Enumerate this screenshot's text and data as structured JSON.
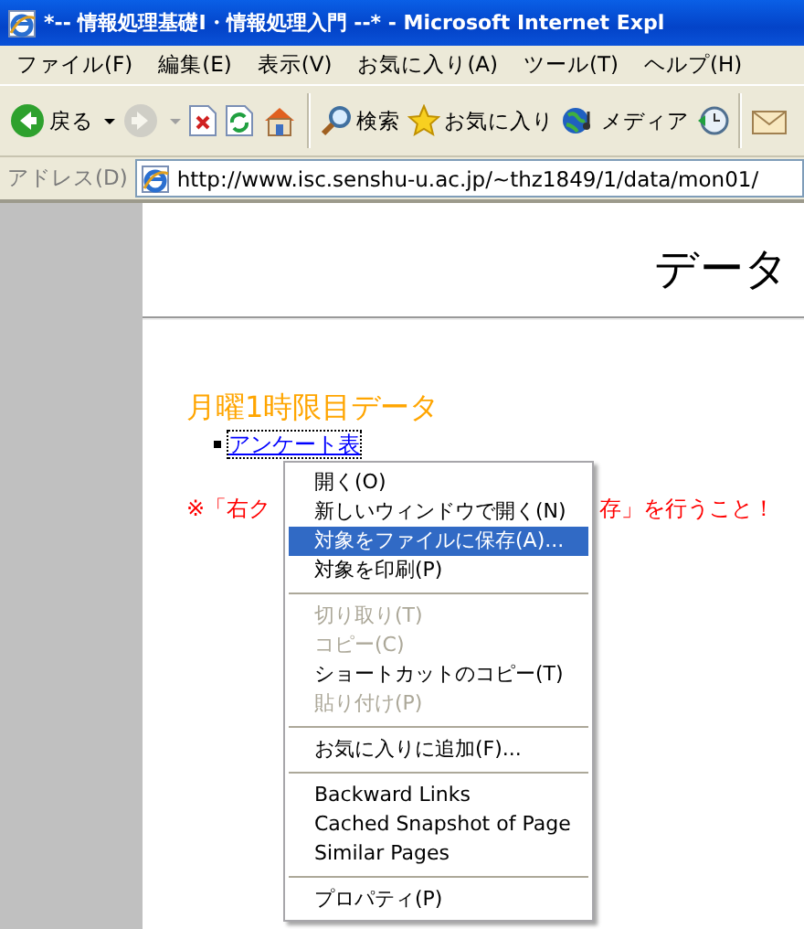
{
  "window": {
    "title": "*-- 情報処理基礎Ⅰ・情報処理入門 --* - Microsoft Internet Expl"
  },
  "menu_bar": [
    "ファイル(F)",
    "編集(E)",
    "表示(V)",
    "お気に入り(A)",
    "ツール(T)",
    "ヘルプ(H)"
  ],
  "toolbar": [
    {
      "kind": "back",
      "label": "戻る",
      "disabled": false
    },
    {
      "kind": "forward",
      "disabled": true
    },
    {
      "kind": "stop",
      "disabled": false
    },
    {
      "kind": "refresh",
      "disabled": false
    },
    {
      "kind": "home",
      "disabled": false
    },
    {
      "kind": "search",
      "label": "検索",
      "disabled": false
    },
    {
      "kind": "favorites",
      "label": "お気に入り",
      "disabled": false
    },
    {
      "kind": "media",
      "label": "メディア",
      "disabled": false
    },
    {
      "kind": "history",
      "disabled": false
    },
    {
      "kind": "mail",
      "disabled": false
    }
  ],
  "address_bar": {
    "label": "アドレス(D)",
    "value": "http://www.isc.senshu-u.ac.jp/~thz1849/1/data/mon01/"
  },
  "page": {
    "heading": "データ",
    "section_title": "月曜1時限目データ",
    "links": [
      "アンケート表"
    ],
    "notice_parts": [
      "※「右ク",
      "存」を行うこと！"
    ]
  },
  "context_menu": [
    {
      "kind": "item",
      "label": "開く(O)",
      "disabled": false,
      "selected": false
    },
    {
      "kind": "item",
      "label": "新しいウィンドウで開く(N)",
      "disabled": false,
      "selected": false
    },
    {
      "kind": "item",
      "label": "対象をファイルに保存(A)...",
      "disabled": false,
      "selected": true
    },
    {
      "kind": "item",
      "label": "対象を印刷(P)",
      "disabled": false,
      "selected": false
    },
    {
      "kind": "separator"
    },
    {
      "kind": "item",
      "label": "切り取り(T)",
      "disabled": true,
      "selected": false
    },
    {
      "kind": "item",
      "label": "コピー(C)",
      "disabled": true,
      "selected": false
    },
    {
      "kind": "item",
      "label": "ショートカットのコピー(T)",
      "disabled": false,
      "selected": false
    },
    {
      "kind": "item",
      "label": "貼り付け(P)",
      "disabled": true,
      "selected": false
    },
    {
      "kind": "separator"
    },
    {
      "kind": "item",
      "label": "お気に入りに追加(F)...",
      "disabled": false,
      "selected": false
    },
    {
      "kind": "separator"
    },
    {
      "kind": "item",
      "label": "Backward Links",
      "disabled": false,
      "selected": false
    },
    {
      "kind": "item",
      "label": "Cached Snapshot of Page",
      "disabled": false,
      "selected": false
    },
    {
      "kind": "item",
      "label": "Similar Pages",
      "disabled": false,
      "selected": false
    },
    {
      "kind": "separator"
    },
    {
      "kind": "item",
      "label": "プロパティ(P)",
      "disabled": false,
      "selected": false
    }
  ]
}
